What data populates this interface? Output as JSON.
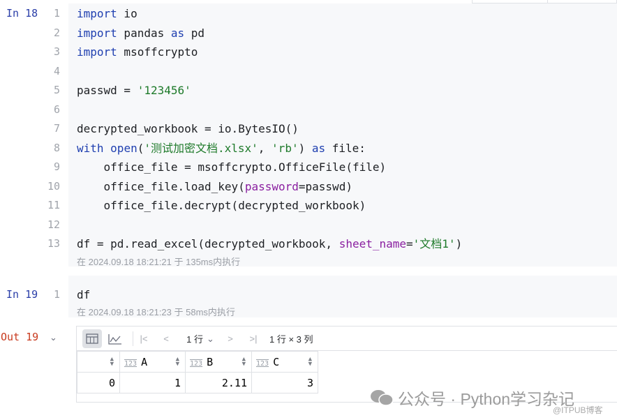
{
  "cells": [
    {
      "prompt": "In 18",
      "meta": "在 2024.09.18 18:21:21 于 135ms内执行",
      "lines": [
        [
          [
            "import",
            "kw"
          ],
          [
            " io",
            ""
          ]
        ],
        [
          [
            "import",
            "kw"
          ],
          [
            " pandas ",
            ""
          ],
          [
            "as",
            "kw"
          ],
          [
            " pd",
            ""
          ]
        ],
        [
          [
            "import",
            "kw"
          ],
          [
            " msoffcrypto",
            ""
          ]
        ],
        [],
        [
          [
            "passwd = ",
            ""
          ],
          [
            "'123456'",
            "str"
          ]
        ],
        [],
        [
          [
            "decrypted_workbook = io.BytesIO()",
            ""
          ]
        ],
        [
          [
            "with",
            "kw"
          ],
          [
            " ",
            ""
          ],
          [
            "open",
            "kw"
          ],
          [
            "(",
            ""
          ],
          [
            "'测试加密文档.xlsx'",
            "str"
          ],
          [
            ", ",
            ""
          ],
          [
            "'rb'",
            "str"
          ],
          [
            ") ",
            ""
          ],
          [
            "as",
            "kw"
          ],
          [
            " file:",
            ""
          ]
        ],
        [
          [
            "    office_file = msoffcrypto.OfficeFile(file)",
            ""
          ]
        ],
        [
          [
            "    office_file.load_key(",
            ""
          ],
          [
            "password",
            "param"
          ],
          [
            "=passwd)",
            ""
          ]
        ],
        [
          [
            "    office_file.decrypt(decrypted_workbook)",
            ""
          ]
        ],
        [],
        [
          [
            "df = pd.read_excel(decrypted_workbook, ",
            ""
          ],
          [
            "sheet_name",
            "param"
          ],
          [
            "=",
            ""
          ],
          [
            "'文档1'",
            "str"
          ],
          [
            ")",
            ""
          ]
        ]
      ]
    },
    {
      "prompt": "In 19",
      "meta": "在 2024.09.18 18:21:23 于 58ms内执行",
      "lines": [
        [
          [
            "df",
            ""
          ]
        ]
      ]
    }
  ],
  "output": {
    "prompt": "Out 19",
    "rows_selector": "1 行",
    "shape": "1 行 × 3 列",
    "type_badge": "123",
    "columns": [
      "A",
      "B",
      "C"
    ],
    "rows": [
      {
        "index": "0",
        "values": [
          "1",
          "2.11",
          "3"
        ]
      }
    ]
  },
  "watermark": {
    "text": "公众号 · Python学习杂记",
    "source": "@ITPUB博客"
  }
}
